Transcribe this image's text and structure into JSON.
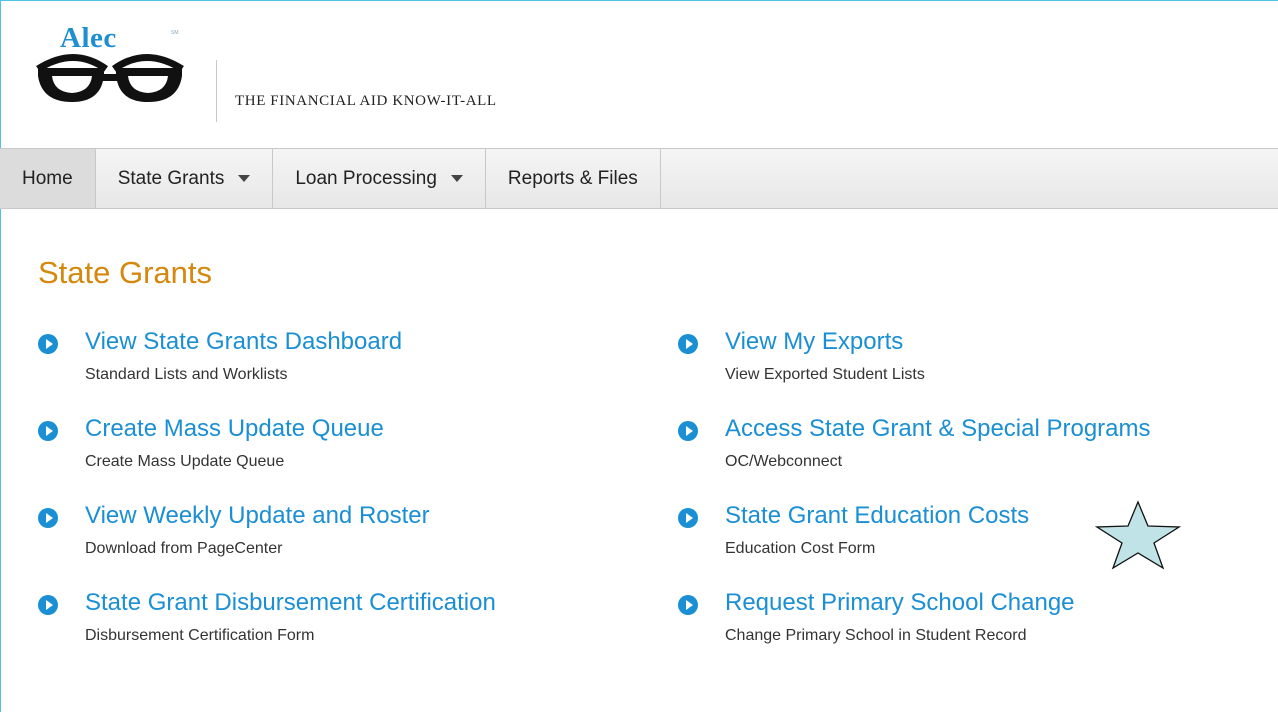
{
  "brand": {
    "logo_word": "Alec",
    "logo_mark": "SM",
    "tagline": "THE FINANCIAL AID KNOW-IT-ALL"
  },
  "nav": {
    "items": [
      {
        "label": "Home",
        "dropdown": false,
        "active": true
      },
      {
        "label": "State Grants",
        "dropdown": true,
        "active": false
      },
      {
        "label": "Loan Processing",
        "dropdown": true,
        "active": false
      },
      {
        "label": "Reports & Files",
        "dropdown": false,
        "active": false
      }
    ]
  },
  "main": {
    "title": "State Grants",
    "left_links": [
      {
        "title": "View State Grants Dashboard",
        "subtitle": "Standard Lists and Worklists"
      },
      {
        "title": "Create Mass Update Queue",
        "subtitle": "Create Mass Update Queue"
      },
      {
        "title": "View Weekly Update and Roster",
        "subtitle": "Download from PageCenter"
      },
      {
        "title": "State Grant Disbursement Certification",
        "subtitle": "Disbursement Certification Form"
      }
    ],
    "right_links": [
      {
        "title": "View My Exports",
        "subtitle": "View Exported Student Lists"
      },
      {
        "title": "Access State Grant & Special Programs",
        "subtitle": "OC/Webconnect"
      },
      {
        "title": "State Grant Education Costs",
        "subtitle": "Education Cost Form"
      },
      {
        "title": "Request Primary School Change",
        "subtitle": "Change Primary School in Student Record"
      }
    ]
  },
  "annotation": {
    "icon": "star-icon",
    "fill": "#bfe3e6"
  },
  "colors": {
    "accent_blue": "#1a8fd3",
    "title_orange": "#d4880d",
    "logo_blue": "#1f8fd0"
  }
}
